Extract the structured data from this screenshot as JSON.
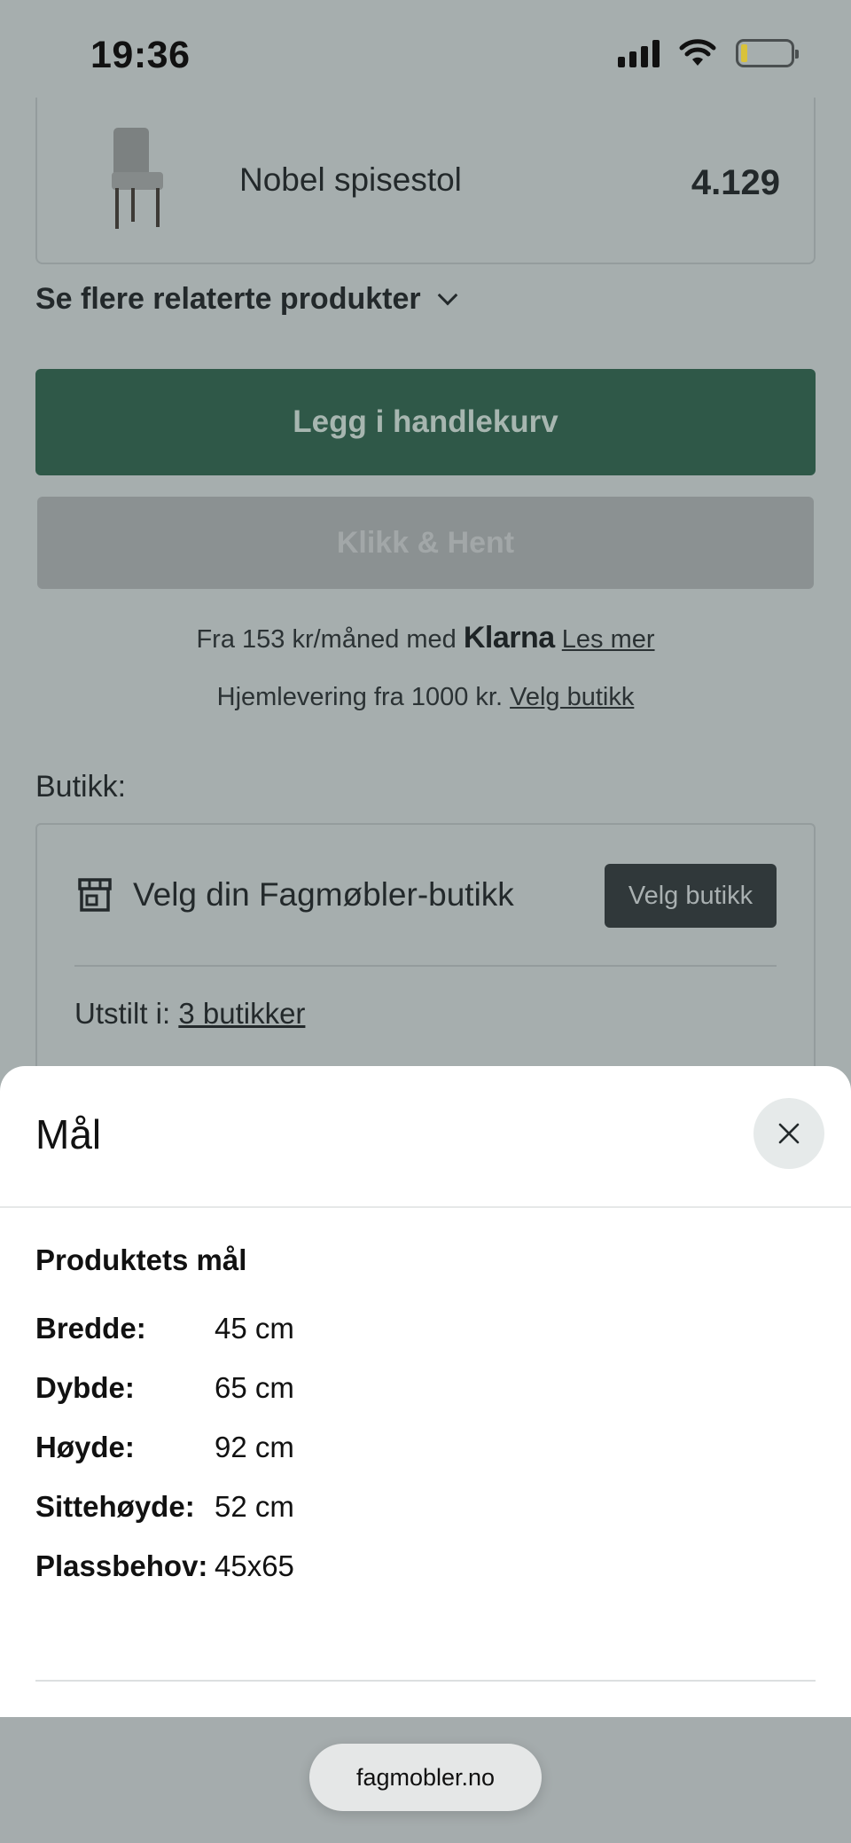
{
  "status_bar": {
    "time": "19:36"
  },
  "product": {
    "name": "Nobel spisestol",
    "price": "4.129"
  },
  "related": {
    "label": "Se flere relaterte produkter"
  },
  "buttons": {
    "add_to_cart": "Legg i handlekurv",
    "click_collect": "Klikk & Hent"
  },
  "klarna": {
    "prefix": "Fra 153 kr/måned med",
    "brand": "Klarna",
    "link": "Les mer"
  },
  "delivery": {
    "text": "Hjemlevering fra 1000 kr.",
    "link": "Velg butikk"
  },
  "store": {
    "section_label": "Butikk:",
    "choose_text": "Velg din Fagmøbler-butikk",
    "choose_button": "Velg butikk",
    "exhibited_prefix": "Utstilt i:",
    "exhibited_link": "3 butikker"
  },
  "sheet": {
    "title": "Mål",
    "heading": "Produktets mål",
    "dimensions": [
      {
        "label": "Bredde:",
        "value": "45 cm"
      },
      {
        "label": "Dybde:",
        "value": "65 cm"
      },
      {
        "label": "Høyde:",
        "value": "92 cm"
      },
      {
        "label": "Sittehøyde:",
        "value": "52 cm"
      },
      {
        "label": "Plassbehov:",
        "value": "45x65"
      }
    ]
  },
  "browser": {
    "url": "fagmobler.no"
  },
  "colors": {
    "primary_green": "#2f5848",
    "dark_button": "#30383a",
    "overlay": "#a6aeae"
  },
  "icons": [
    "signal-icon",
    "wifi-icon",
    "battery-icon",
    "chair-image",
    "chevron-down-icon",
    "store-icon",
    "close-icon"
  ]
}
